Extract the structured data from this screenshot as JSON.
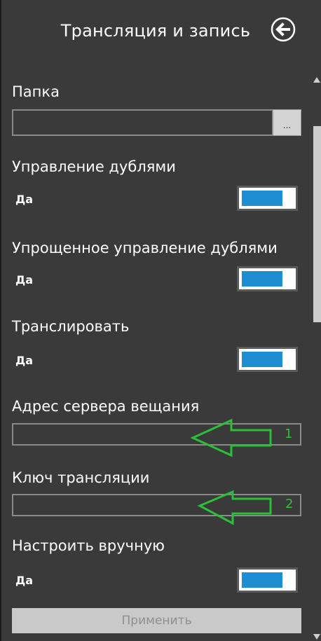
{
  "header": {
    "title": "Трансляция и запись",
    "back_icon": "arrow-left-circle-icon"
  },
  "folder": {
    "label": "Папка",
    "value": "",
    "browse_label": "..."
  },
  "duplicates": {
    "label": "Управление дублями",
    "state_label": "Да",
    "enabled": true
  },
  "simple_duplicates": {
    "label": "Упрощенное управление дублями",
    "state_label": "Да",
    "enabled": true
  },
  "broadcast": {
    "label": "Транслировать",
    "state_label": "Да",
    "enabled": true
  },
  "server_address": {
    "label": "Адрес сервера вещания",
    "value": "",
    "callout_number": "1"
  },
  "stream_key": {
    "label": "Ключ трансляции",
    "value": "",
    "callout_number": "2"
  },
  "manual": {
    "label": "Настроить вручную",
    "state_label": "Да",
    "enabled": true
  },
  "apply": {
    "label": "Применить"
  },
  "colors": {
    "panel_bg": "#3a3a3a",
    "toggle_on": "#1f8ed1",
    "callout": "#2bbf3a",
    "text": "#ffffff"
  }
}
